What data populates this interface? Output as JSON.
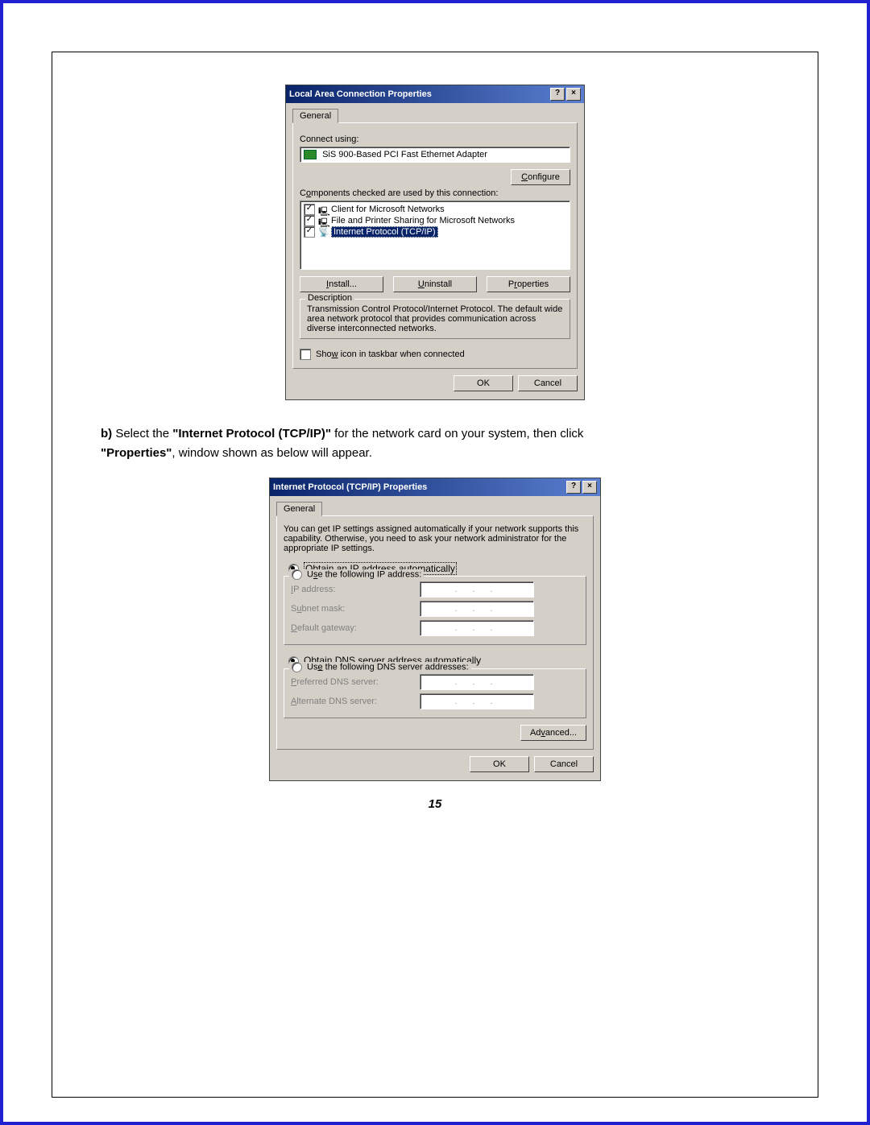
{
  "dialog1": {
    "title": "Local Area Connection Properties",
    "tab": "General",
    "connect_using_label": "Connect using:",
    "adapter": "SiS 900-Based PCI Fast Ethernet Adapter",
    "configure_btn": "Configure",
    "components_label": "Components checked are used by this connection:",
    "items": [
      "Client for Microsoft Networks",
      "File and Printer Sharing for Microsoft Networks",
      "Internet Protocol (TCP/IP)"
    ],
    "install_btn": "Install...",
    "uninstall_btn": "Uninstall",
    "properties_btn": "Properties",
    "desc_legend": "Description",
    "desc_text": "Transmission Control Protocol/Internet Protocol. The default wide area network protocol that provides communication across diverse interconnected networks.",
    "show_icon": "Show icon in taskbar when connected",
    "ok": "OK",
    "cancel": "Cancel"
  },
  "instruction": {
    "prefix": "b)",
    "part1": " Select the ",
    "bold1": "\"Internet Protocol (TCP/IP)\"",
    "part2": " for the network card on your system, then click ",
    "bold2": "\"Properties\"",
    "part3": ", window shown as below will appear."
  },
  "dialog2": {
    "title": "Internet Protocol (TCP/IP) Properties",
    "tab": "General",
    "intro": "You can get IP settings assigned automatically if your network supports this capability. Otherwise, you need to ask your network administrator for the appropriate IP settings.",
    "r1": "Obtain an IP address automatically",
    "r2": "Use the following IP address:",
    "ip_label": "IP address:",
    "subnet_label": "Subnet mask:",
    "gateway_label": "Default gateway:",
    "r3": "Obtain DNS server address automatically",
    "r4": "Use the following DNS server addresses:",
    "dns1_label": "Preferred DNS server:",
    "dns2_label": "Alternate DNS server:",
    "advanced_btn": "Advanced...",
    "ok": "OK",
    "cancel": "Cancel"
  },
  "page_number": "15"
}
